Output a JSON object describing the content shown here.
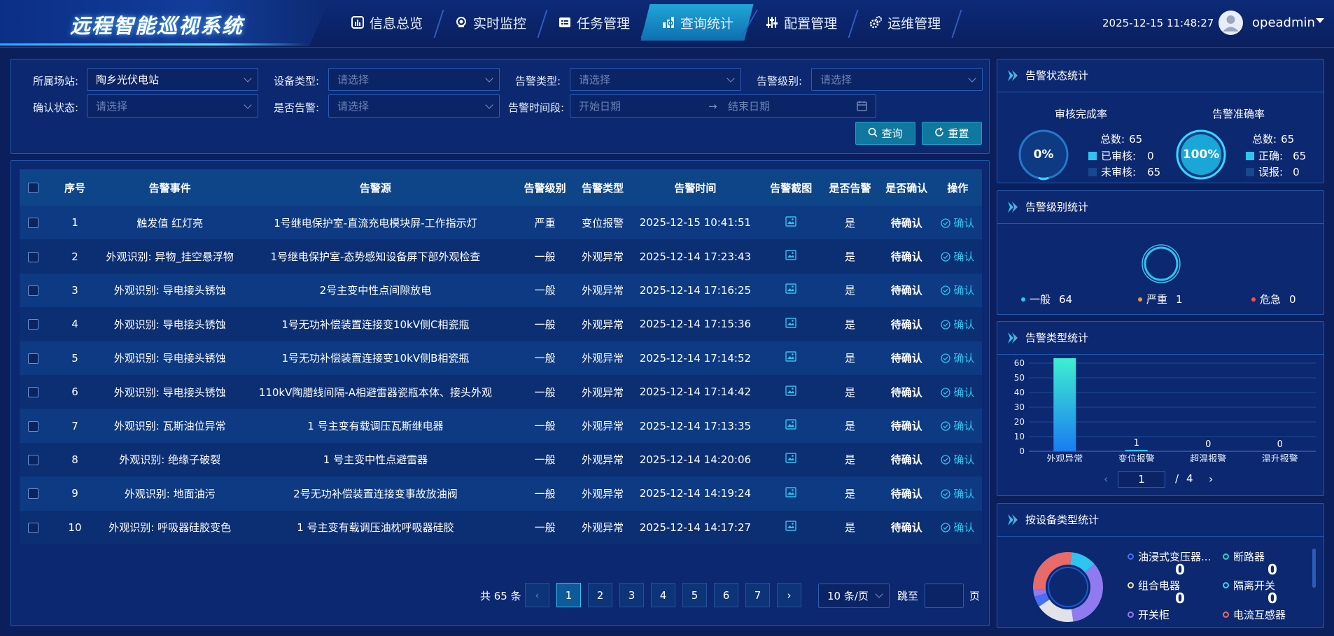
{
  "header": {
    "title": "远程智能巡视系统",
    "nav": [
      {
        "label": "信息总览",
        "icon": "chart-icon",
        "active": false
      },
      {
        "label": "实时监控",
        "icon": "camera-icon",
        "active": false
      },
      {
        "label": "任务管理",
        "icon": "task-icon",
        "active": false
      },
      {
        "label": "查询统计",
        "icon": "statistics-icon",
        "active": true
      },
      {
        "label": "配置管理",
        "icon": "sliders-icon",
        "active": false
      },
      {
        "label": "运维管理",
        "icon": "gears-icon",
        "active": false
      }
    ],
    "datetime": "2025-12-15 11:48:27",
    "username": "opeadmin"
  },
  "filters": {
    "station_label": "所属场站:",
    "station_value": "陶乡光伏电站",
    "device_type_label": "设备类型:",
    "alarm_type_label": "告警类型:",
    "alarm_level_label": "告警级别:",
    "confirm_status_label": "确认状态:",
    "is_alarm_label": "是否告警:",
    "time_range_label": "告警时间段:",
    "placeholder": "请选择",
    "start_date_placeholder": "开始日期",
    "end_date_placeholder": "结束日期",
    "range_arrow": "→",
    "query_label": "查询",
    "reset_label": "重置"
  },
  "table": {
    "columns": [
      "序号",
      "告警事件",
      "告警源",
      "告警级别",
      "告警类型",
      "告警时间",
      "告警截图",
      "是否告警",
      "是否确认",
      "操作"
    ],
    "rows": [
      {
        "index": "1",
        "event": "触发值 红灯亮",
        "source": "1号继电保护室-直流充电模块屏-工作指示灯",
        "level": "严重",
        "type": "变位报警",
        "time": "2025-12-15 10:41:51",
        "is_alarm": "是",
        "confirmed": "待确认",
        "action": "确认"
      },
      {
        "index": "2",
        "event": "外观识别: 异物_挂空悬浮物",
        "source": "1号继电保护室-态势感知设备屏下部外观检查",
        "level": "一般",
        "type": "外观异常",
        "time": "2025-12-14 17:23:43",
        "is_alarm": "是",
        "confirmed": "待确认",
        "action": "确认"
      },
      {
        "index": "3",
        "event": "外观识别: 导电接头锈蚀",
        "source": "2号主变中性点间隙放电",
        "level": "一般",
        "type": "外观异常",
        "time": "2025-12-14 17:16:25",
        "is_alarm": "是",
        "confirmed": "待确认",
        "action": "确认"
      },
      {
        "index": "4",
        "event": "外观识别: 导电接头锈蚀",
        "source": "1号无功补偿装置连接变10kV侧C相瓷瓶",
        "level": "一般",
        "type": "外观异常",
        "time": "2025-12-14 17:15:36",
        "is_alarm": "是",
        "confirmed": "待确认",
        "action": "确认"
      },
      {
        "index": "5",
        "event": "外观识别: 导电接头锈蚀",
        "source": "1号无功补偿装置连接变10kV侧B相瓷瓶",
        "level": "一般",
        "type": "外观异常",
        "time": "2025-12-14 17:14:52",
        "is_alarm": "是",
        "confirmed": "待确认",
        "action": "确认"
      },
      {
        "index": "6",
        "event": "外观识别: 导电接头锈蚀",
        "source": "110kV陶腊线间隔-A相避雷器瓷瓶本体、接头外观",
        "level": "一般",
        "type": "外观异常",
        "time": "2025-12-14 17:14:42",
        "is_alarm": "是",
        "confirmed": "待确认",
        "action": "确认"
      },
      {
        "index": "7",
        "event": "外观识别: 瓦斯油位异常",
        "source": "1 号主变有载调压瓦斯继电器",
        "level": "一般",
        "type": "外观异常",
        "time": "2025-12-14 17:13:35",
        "is_alarm": "是",
        "confirmed": "待确认",
        "action": "确认"
      },
      {
        "index": "8",
        "event": "外观识别: 绝缘子破裂",
        "source": "1 号主变中性点避雷器",
        "level": "一般",
        "type": "外观异常",
        "time": "2025-12-14 14:20:06",
        "is_alarm": "是",
        "confirmed": "待确认",
        "action": "确认"
      },
      {
        "index": "9",
        "event": "外观识别: 地面油污",
        "source": "2号无功补偿装置连接变事故放油阀",
        "level": "一般",
        "type": "外观异常",
        "time": "2025-12-14 14:19:24",
        "is_alarm": "是",
        "confirmed": "待确认",
        "action": "确认"
      },
      {
        "index": "10",
        "event": "外观识别: 呼吸器硅胶变色",
        "source": "1 号主变有载调压油枕呼吸器硅胶",
        "level": "一般",
        "type": "外观异常",
        "time": "2025-12-14 14:17:27",
        "is_alarm": "是",
        "confirmed": "待确认",
        "action": "确认"
      }
    ]
  },
  "pagination": {
    "total": "共 65 条",
    "pages": [
      "1",
      "2",
      "3",
      "4",
      "5",
      "6",
      "7"
    ],
    "current": "1",
    "page_size": "10 条/页",
    "jump_label": "跳至",
    "page_suffix": "页"
  },
  "alarm_status": {
    "title": "告警状态统计",
    "review_title": "审核完成率",
    "review_rate": "0%",
    "review_rate_value": 0,
    "review_total_label": "总数:",
    "review_total": "65",
    "reviewed_label": "已审核:",
    "reviewed": "0",
    "unreviewed_label": "未审核:",
    "unreviewed": "65",
    "accuracy_title": "告警准确率",
    "accuracy_rate": "100%",
    "accuracy_rate_value": 100,
    "accuracy_total_label": "总数:",
    "accuracy_total": "65",
    "correct_label": "正确:",
    "correct": "65",
    "false_label": "误报:",
    "false_count": "0"
  },
  "alarm_level": {
    "title": "告警级别统计",
    "legend": [
      {
        "label": "一般",
        "value": "64",
        "color": "#2fc3f0"
      },
      {
        "label": "严重",
        "value": "1",
        "color": "#e8983a"
      },
      {
        "label": "危急",
        "value": "0",
        "color": "#ff4d4f"
      }
    ]
  },
  "alarm_type": {
    "title": "告警类型统计",
    "pager_current": "1",
    "pager_sep": "/",
    "pager_total": "4"
  },
  "chart_data": {
    "type": "bar",
    "categories": [
      "外观异常",
      "变位报警",
      "超温报警",
      "温升报警"
    ],
    "values": [
      64,
      1,
      0,
      0
    ],
    "value_labels": [
      "64",
      "1",
      "0",
      "0"
    ],
    "yticks": [
      "0",
      "10",
      "20",
      "30",
      "40",
      "50",
      "60",
      "70"
    ],
    "ylim": [
      0,
      70
    ],
    "xlabel": "",
    "ylabel": ""
  },
  "device_type": {
    "title": "按设备类型统计",
    "legend": [
      {
        "label": "油浸式变压器...",
        "value": "0",
        "color": "#4a6cf7"
      },
      {
        "label": "断路器",
        "value": "0",
        "color": "#2ad1c4"
      },
      {
        "label": "组合电器",
        "value": "0",
        "color": "#f2e6a0"
      },
      {
        "label": "隔离开关",
        "value": "0",
        "color": "#35d0f0"
      },
      {
        "label": "开关柜",
        "value": "",
        "color": "#8f7af0"
      },
      {
        "label": "电流互感器",
        "value": "",
        "color": "#e86a6a"
      }
    ],
    "donut_colors": [
      "#2fc3f0",
      "#8f7af0",
      "#e2e2ea",
      "#4a6cf7",
      "#8f7af0",
      "#e86a6a"
    ],
    "donut_shares": [
      0.12,
      0.34,
      0.18,
      0.05,
      0.03,
      0.28
    ]
  }
}
